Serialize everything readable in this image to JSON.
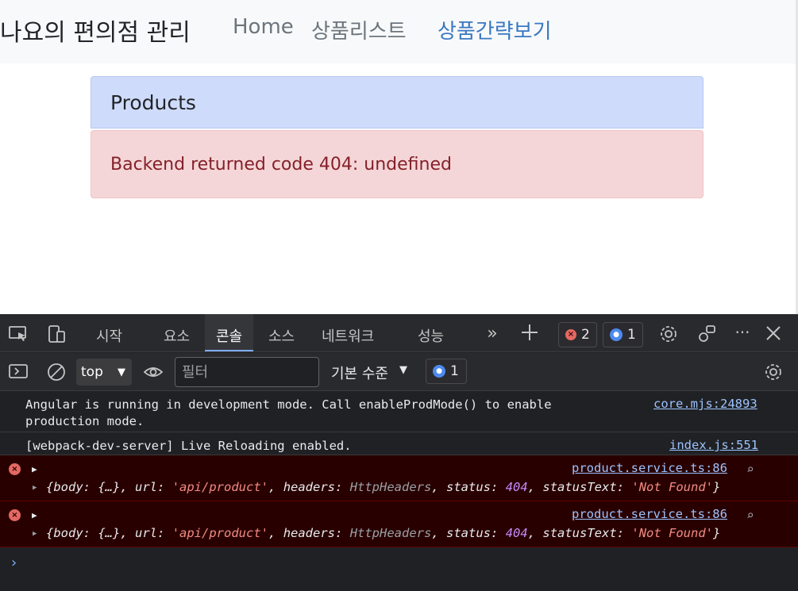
{
  "page": {
    "brand": "나요의 편의점 관리",
    "nav": [
      {
        "label": "Home",
        "active": false
      },
      {
        "label": "상품리스트",
        "active": false
      },
      {
        "label": "상품간략보기",
        "active": true
      }
    ],
    "panel_title": "Products",
    "error_message": "Backend returned code 404: undefined"
  },
  "devtools": {
    "tabs": [
      "시작",
      "요소",
      "콘솔",
      "소스",
      "네트워크",
      "성능"
    ],
    "active_tab": "콘솔",
    "error_count": "2",
    "message_count": "1",
    "toolbar": {
      "context": "top",
      "filter_placeholder": "필터",
      "level": "기본 수준",
      "issues_count": "1"
    },
    "logs": [
      {
        "type": "info",
        "text": "Angular is running in development mode. Call enableProdMode() to enable production mode.",
        "source": "core.mjs:24893"
      },
      {
        "type": "info",
        "text": "[webpack-dev-server] Live Reloading enabled.",
        "source": "index.js:551"
      },
      {
        "type": "error",
        "source": "product.service.ts:86",
        "object": {
          "body": "{…}",
          "url": "'api/product'",
          "headers": "HttpHeaders",
          "status": "404",
          "statusText": "'Not Found'"
        }
      },
      {
        "type": "error",
        "source": "product.service.ts:86",
        "object": {
          "body": "{…}",
          "url": "'api/product'",
          "headers": "HttpHeaders",
          "status": "404",
          "statusText": "'Not Found'"
        }
      }
    ]
  },
  "colors": {
    "nav_active": "#3a78c2",
    "panel_bg": "#cfdbfa",
    "alert_bg": "#f5d6d8",
    "alert_text": "#842029",
    "devtools_bg": "#202124",
    "error_row_bg": "#290000",
    "link": "#9cc3ff"
  },
  "icons": [
    "inspect-icon",
    "device-toggle-icon",
    "more-tabs-icon",
    "add-tab-icon",
    "settings-icon",
    "customize-icon",
    "more-options-icon",
    "close-icon",
    "sidebar-toggle-icon",
    "clear-console-icon",
    "live-expression-icon",
    "chevron-down-icon",
    "search-icon",
    "console-prompt-icon"
  ]
}
